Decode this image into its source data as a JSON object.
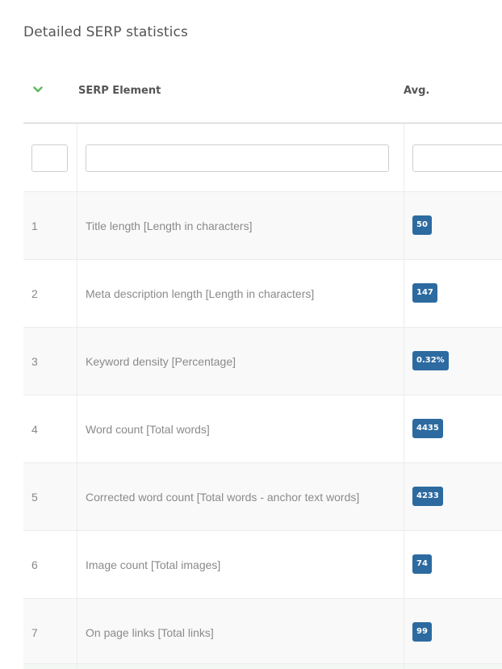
{
  "title": "Detailed SERP statistics",
  "table": {
    "headers": {
      "sort_icon": "chevron-down-icon",
      "element": "SERP Element",
      "avg": "Avg."
    },
    "filters": {
      "num_value": "",
      "element_value": "",
      "avg_value": ""
    },
    "rows": [
      {
        "num": "1",
        "label": "Title length [Length in characters]",
        "avg": "50"
      },
      {
        "num": "2",
        "label": "Meta description length [Length in characters]",
        "avg": "147"
      },
      {
        "num": "3",
        "label": "Keyword density [Percentage]",
        "avg": "0.32%"
      },
      {
        "num": "4",
        "label": "Word count [Total words]",
        "avg": "4435"
      },
      {
        "num": "5",
        "label": "Corrected word count [Total words - anchor text words]",
        "avg": "4233"
      },
      {
        "num": "6",
        "label": "Image count [Total images]",
        "avg": "74"
      },
      {
        "num": "7",
        "label": "On page links [Total links]",
        "avg": "99"
      }
    ]
  },
  "colors": {
    "badge": "#2c6aa0",
    "sort_icon": "#5cb85c",
    "text": "#555555"
  }
}
